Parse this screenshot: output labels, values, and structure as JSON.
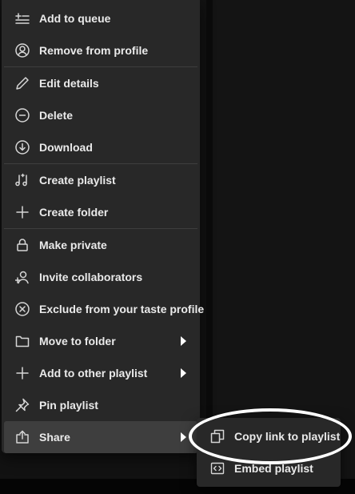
{
  "context_menu": {
    "items": [
      {
        "label": "Add to queue",
        "icon": "add-to-queue-icon"
      },
      {
        "label": "Remove from profile",
        "icon": "user-icon"
      },
      {
        "label": "Edit details",
        "icon": "pencil-icon"
      },
      {
        "label": "Delete",
        "icon": "minus-circle-icon"
      },
      {
        "label": "Download",
        "icon": "download-circle-icon"
      },
      {
        "label": "Create playlist",
        "icon": "create-playlist-icon"
      },
      {
        "label": "Create folder",
        "icon": "plus-icon"
      },
      {
        "label": "Make private",
        "icon": "lock-icon"
      },
      {
        "label": "Invite collaborators",
        "icon": "add-user-icon"
      },
      {
        "label": "Exclude from your taste profile",
        "icon": "x-circle-icon"
      },
      {
        "label": "Move to folder",
        "icon": "folder-icon"
      },
      {
        "label": "Add to other playlist",
        "icon": "plus-icon"
      },
      {
        "label": "Pin playlist",
        "icon": "pin-icon"
      },
      {
        "label": "Share",
        "icon": "share-icon"
      }
    ]
  },
  "share_submenu": {
    "items": [
      {
        "label": "Copy link to playlist",
        "icon": "copy-icon"
      },
      {
        "label": "Embed playlist",
        "icon": "embed-icon"
      }
    ]
  },
  "colors": {
    "menu_background": "#282828",
    "active_item": "#3e3e3e",
    "text": "#eaeaea",
    "highlight_annotation": "#ffffff"
  }
}
